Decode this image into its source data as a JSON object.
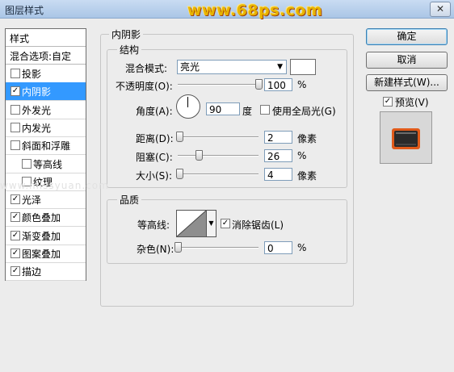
{
  "window": {
    "title": "图层样式",
    "watermark": "www.68ps.com",
    "close_glyph": "✕"
  },
  "sidebar": {
    "header": "样式",
    "blend_header": "混合选项:自定",
    "items": [
      {
        "label": "投影",
        "checked": false,
        "selected": false,
        "indent": false
      },
      {
        "label": "内阴影",
        "checked": true,
        "selected": true,
        "indent": false
      },
      {
        "label": "外发光",
        "checked": false,
        "selected": false,
        "indent": false
      },
      {
        "label": "内发光",
        "checked": false,
        "selected": false,
        "indent": false
      },
      {
        "label": "斜面和浮雕",
        "checked": false,
        "selected": false,
        "indent": false
      },
      {
        "label": "等高线",
        "checked": false,
        "selected": false,
        "indent": true
      },
      {
        "label": "纹理",
        "checked": false,
        "selected": false,
        "indent": true
      },
      {
        "label": "光泽",
        "checked": true,
        "selected": false,
        "indent": false
      },
      {
        "label": "颜色叠加",
        "checked": true,
        "selected": false,
        "indent": false
      },
      {
        "label": "渐变叠加",
        "checked": true,
        "selected": false,
        "indent": false
      },
      {
        "label": "图案叠加",
        "checked": true,
        "selected": false,
        "indent": false
      },
      {
        "label": "描边",
        "checked": true,
        "selected": false,
        "indent": false
      }
    ]
  },
  "inner_shadow": {
    "section_title": "内阴影",
    "structure": {
      "title": "结构",
      "blend_mode_label": "混合模式:",
      "blend_mode_value": "亮光",
      "blend_color": "#ffffff",
      "opacity_label": "不透明度(O):",
      "opacity_value": "100",
      "opacity_level": 1.0,
      "percent_unit": "%",
      "angle_label": "角度(A):",
      "angle_value": "90",
      "angle_unit": "度",
      "global_light_label": "使用全局光(G)",
      "global_light_checked": false,
      "distance_label": "距离(D):",
      "distance_value": "2",
      "distance_level": 0.02,
      "pixel_unit": "像素",
      "choke_label": "阻塞(C):",
      "choke_value": "26",
      "choke_level": 0.26,
      "size_label": "大小(S):",
      "size_value": "4",
      "size_level": 0.016
    },
    "quality": {
      "title": "品质",
      "contour_label": "等高线:",
      "antialias_label": "消除锯齿(L)",
      "antialias_checked": true,
      "noise_label": "杂色(N):",
      "noise_value": "0",
      "noise_level": 0.0
    }
  },
  "buttons": {
    "ok": "确定",
    "cancel": "取消",
    "new_style": "新建样式(W)...",
    "preview_label": "预览(V)",
    "preview_checked": true
  },
  "faint_watermark": "www.missyuan.com"
}
